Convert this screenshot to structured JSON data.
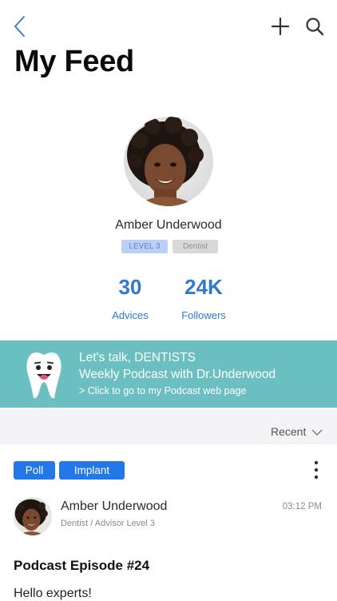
{
  "header": {
    "title": "My Feed",
    "icons": {
      "back": "back-icon",
      "add": "plus-icon",
      "search": "search-icon"
    }
  },
  "profile": {
    "name": "Amber Underwood",
    "level_badge": "LEVEL 3",
    "role_badge": "Dentist",
    "stats": [
      {
        "value": "30",
        "label": "Advices"
      },
      {
        "value": "24K",
        "label": "Followers"
      }
    ]
  },
  "banner": {
    "line1": "Let's talk, DENTISTS",
    "line2": "Weekly Podcast with Dr.Underwood",
    "line3": "> Click to go to my Podcast web page",
    "icon": "tooth-icon"
  },
  "sort": {
    "label": "Recent"
  },
  "post": {
    "tags": [
      "Poll",
      "Implant"
    ],
    "author": "Amber Underwood",
    "author_subtitle": "Dentist / Advisor Level 3",
    "time": "03:12 PM",
    "title": "Podcast Episode #24",
    "body": "Hello experts!"
  },
  "colors": {
    "accent": "#2f78d1",
    "banner": "#6bbfc0",
    "tag": "#2477e6",
    "sort_bar": "#f4f4f6"
  }
}
